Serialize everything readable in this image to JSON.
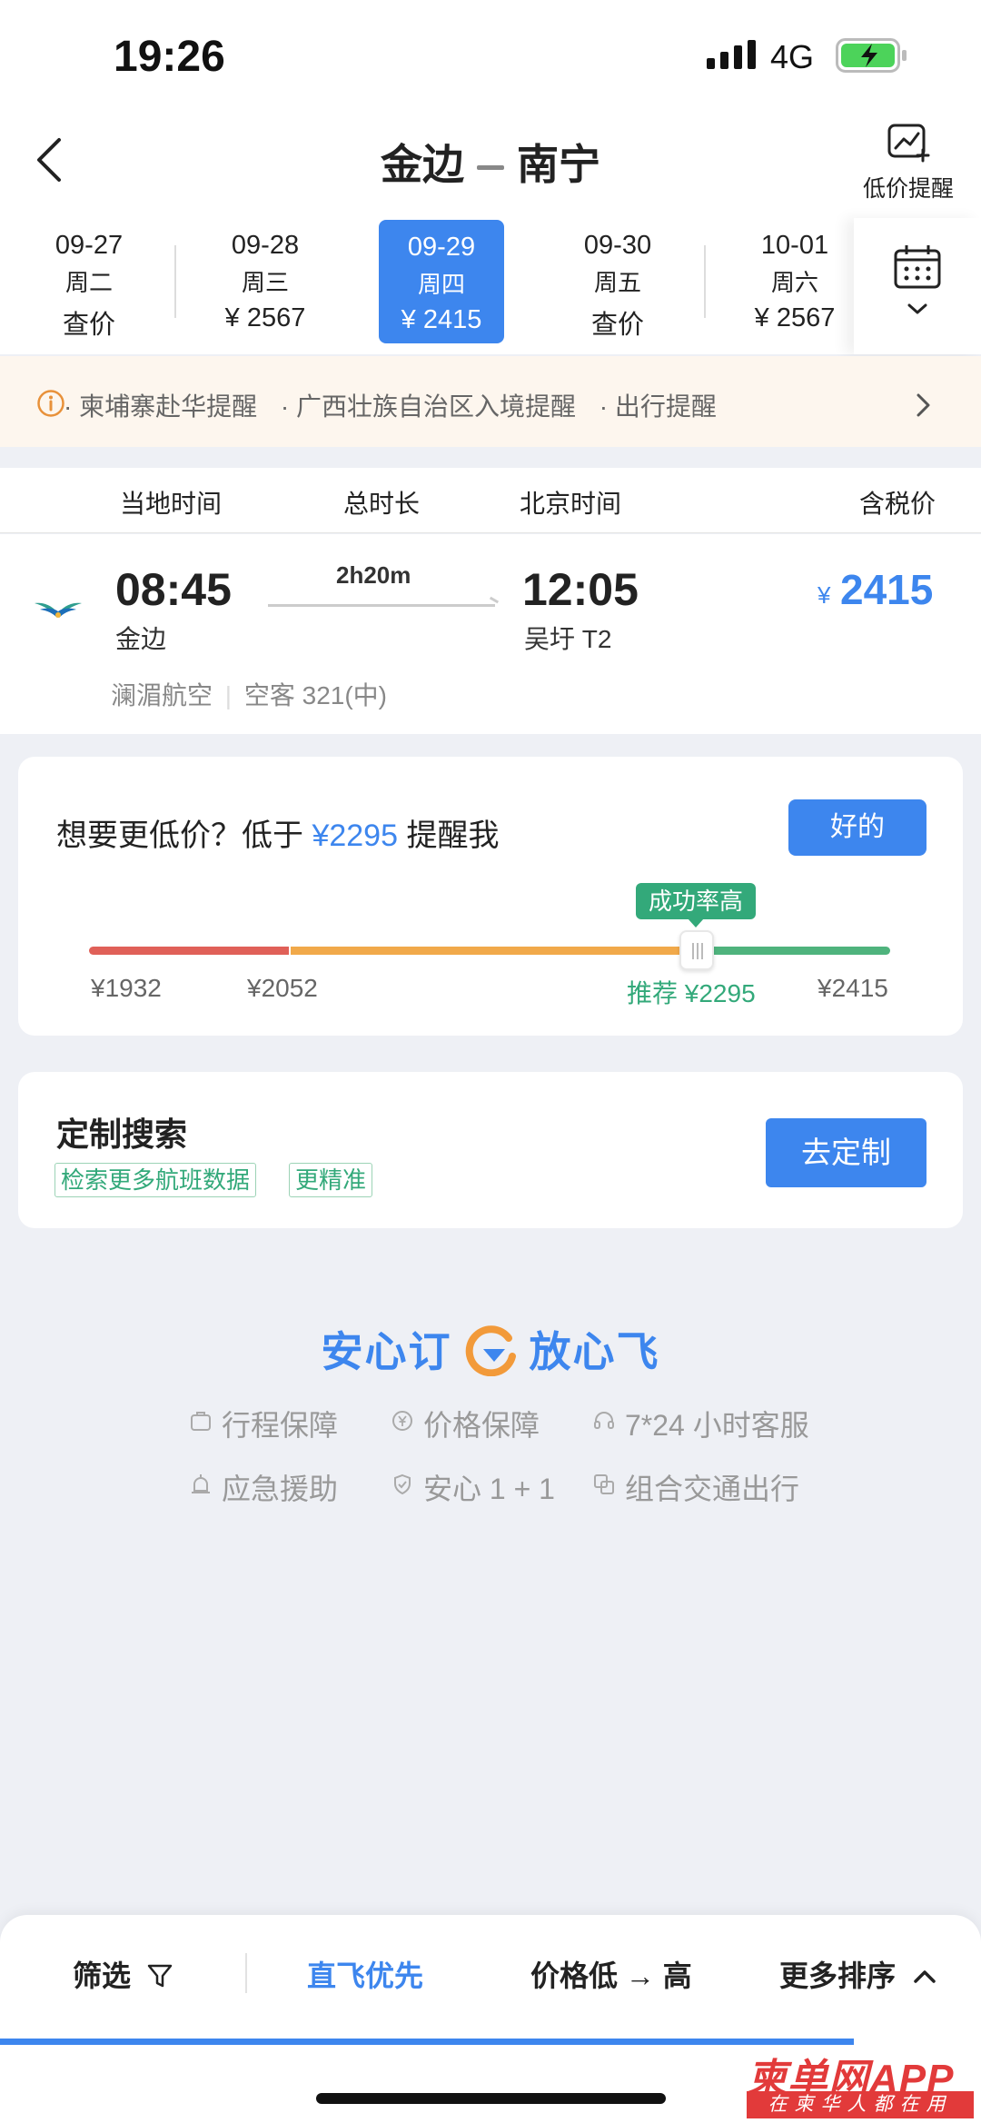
{
  "status_bar": {
    "time": "19:26",
    "network": "4G"
  },
  "header": {
    "origin": "金边",
    "destination": "南宁",
    "low_price_alert_label": "低价提醒"
  },
  "dates": [
    {
      "date": "09-27",
      "weekday": "周二",
      "price": "查价",
      "active": false
    },
    {
      "date": "09-28",
      "weekday": "周三",
      "price": "¥ 2567",
      "active": false
    },
    {
      "date": "09-29",
      "weekday": "周四",
      "price": "¥ 2415",
      "active": true
    },
    {
      "date": "09-30",
      "weekday": "周五",
      "price": "查价",
      "active": false
    },
    {
      "date": "10-01",
      "weekday": "周六",
      "price": "¥ 2567",
      "active": false
    }
  ],
  "notices": [
    "· 柬埔寨赴华提醒",
    "· 广西壮族自治区入境提醒",
    "· 出行提醒"
  ],
  "columns": {
    "local_time": "当地时间",
    "duration": "总时长",
    "beijing_time": "北京时间",
    "price": "含税价"
  },
  "flight": {
    "dep_time": "08:45",
    "dep_airport": "金边",
    "duration": "2h20m",
    "arr_time": "12:05",
    "arr_airport": "吴圩 T2",
    "currency": "¥",
    "price": "2415",
    "airline": "澜湄航空",
    "aircraft": "空客 321(中)"
  },
  "price_alert": {
    "prefix": "想要更低价？低于",
    "target": "¥2295",
    "suffix": "提醒我",
    "ok_label": "好的",
    "badge": "成功率高",
    "ticks": [
      "¥1932",
      "¥2052",
      "推荐 ¥2295",
      "¥2415"
    ]
  },
  "custom_search": {
    "title": "定制搜索",
    "tags": [
      "检索更多航班数据",
      "更精准"
    ],
    "button": "去定制"
  },
  "slogan": {
    "left": "安心订",
    "right": "放心飞"
  },
  "guarantees": [
    "行程保障",
    "价格保障",
    "7*24 小时客服",
    "应急援助",
    "安心 1 + 1",
    "组合交通出行"
  ],
  "bottom_bar": {
    "filter": "筛选",
    "direct_first": "直飞优先",
    "price_sort": "价格低 → 高",
    "more_sort": "更多排序"
  },
  "watermark": {
    "main": "柬单网APP",
    "sub": "在柬华人都在用"
  },
  "colors": {
    "accent": "#3d86ee",
    "success": "#33a97a",
    "warn": "#f1a94a",
    "danger": "#e06058",
    "notice_bg": "#fdf6ee"
  }
}
